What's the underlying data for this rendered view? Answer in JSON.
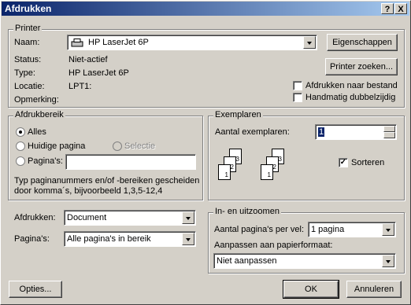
{
  "window": {
    "title": "Afdrukken",
    "help_label": "?",
    "close_label": "X"
  },
  "printer": {
    "group_label": "Printer",
    "name_label": "Naam:",
    "name_value": "HP LaserJet 6P",
    "properties_button": "Eigenschappen",
    "find_printer_button": "Printer zoeken...",
    "status_label": "Status:",
    "status_value": "Niet-actief",
    "type_label": "Type:",
    "type_value": "HP LaserJet 6P",
    "location_label": "Locatie:",
    "location_value": "LPT1:",
    "comment_label": "Opmerking:",
    "print_to_file_label": "Afdrukken naar bestand",
    "manual_duplex_label": "Handmatig dubbelzijdig"
  },
  "range": {
    "group_label": "Afdrukbereik",
    "all_label": "Alles",
    "current_page_label": "Huidige pagina",
    "selection_label": "Selectie",
    "pages_label": "Pagina's:",
    "pages_value": "",
    "hint_line1": "Typ paginanummers en/of -bereiken gescheiden",
    "hint_line2": "door komma´s, bijvoorbeeld 1,3,5-12,4"
  },
  "copies": {
    "group_label": "Exemplaren",
    "count_label": "Aantal exemplaren:",
    "count_value": "1",
    "collate_label": "Sorteren",
    "collate_checked": true,
    "page_numbers": [
      "1",
      "2",
      "3",
      "1",
      "2",
      "3"
    ]
  },
  "print_what": {
    "label": "Afdrukken:",
    "value": "Document"
  },
  "print_pages": {
    "label": "Pagina's:",
    "value": "Alle pagina's in bereik"
  },
  "zoom": {
    "group_label": "In- en uitzoomen",
    "pages_per_sheet_label": "Aantal pagina's per vel:",
    "pages_per_sheet_value": "1 pagina",
    "scale_label": "Aanpassen aan papierformaat:",
    "scale_value": "Niet aanpassen"
  },
  "footer": {
    "options_button": "Opties...",
    "ok_button": "OK",
    "cancel_button": "Annuleren"
  }
}
